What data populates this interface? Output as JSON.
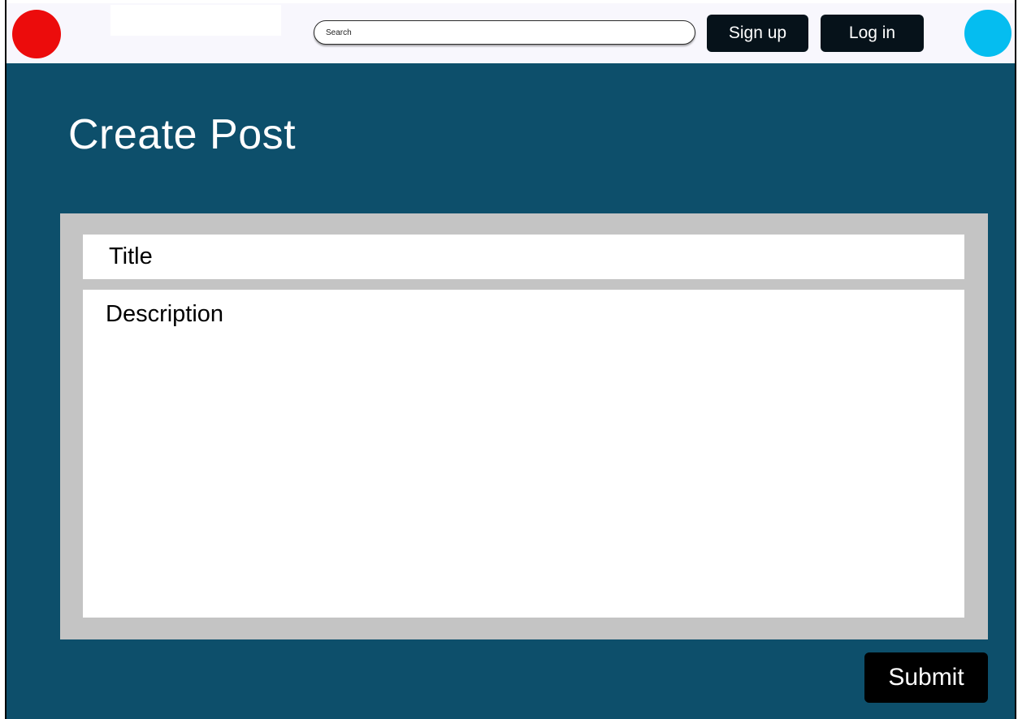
{
  "header": {
    "logo_icon": "red-circle-logo",
    "logo_color": "#ec0c0c",
    "search": {
      "placeholder": "Search",
      "value": ""
    },
    "signup_label": "Sign up",
    "login_label": "Log in",
    "avatar_icon": "blue-circle-avatar",
    "avatar_color": "#05bdf0"
  },
  "main": {
    "background_color": "#0d4f6b",
    "title": "Create Post",
    "form": {
      "title_placeholder": "Title",
      "description_placeholder": "Description"
    },
    "submit_label": "Submit"
  }
}
